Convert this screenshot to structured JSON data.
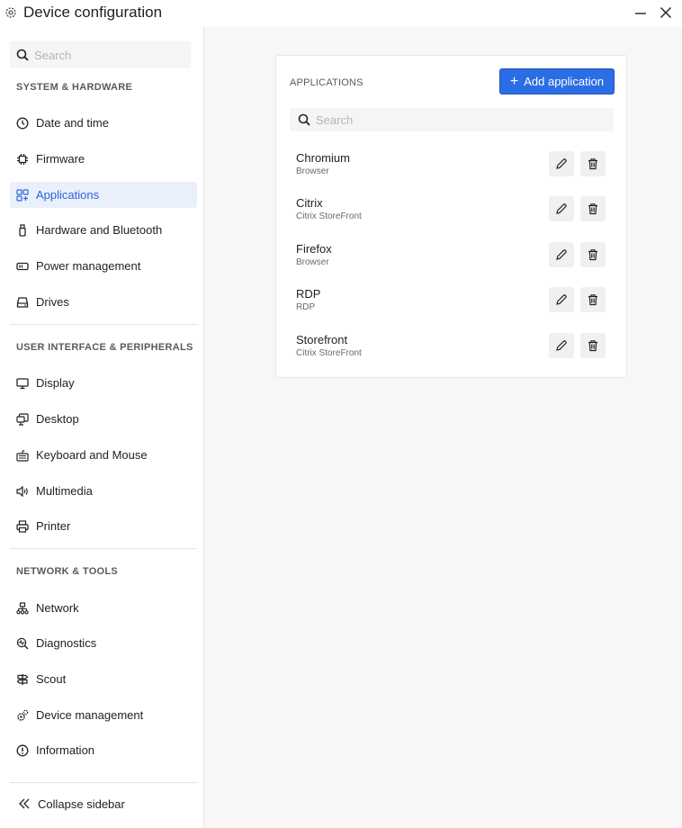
{
  "window": {
    "title": "Device configuration",
    "icon": "gear-icon"
  },
  "sidebar": {
    "search_placeholder": "Search",
    "sections": [
      {
        "label": "SYSTEM & HARDWARE",
        "items": [
          {
            "label": "Date and time",
            "icon": "clock-icon"
          },
          {
            "label": "Firmware",
            "icon": "chip-icon"
          },
          {
            "label": "Applications",
            "icon": "apps-icon",
            "active": true
          },
          {
            "label": "Hardware and Bluetooth",
            "icon": "usb-icon"
          },
          {
            "label": "Power management",
            "icon": "battery-icon"
          },
          {
            "label": "Drives",
            "icon": "drive-icon"
          }
        ]
      },
      {
        "label": "USER INTERFACE & PERIPHERALS",
        "items": [
          {
            "label": "Display",
            "icon": "monitor-icon"
          },
          {
            "label": "Desktop",
            "icon": "desktop-icon"
          },
          {
            "label": "Keyboard and Mouse",
            "icon": "keyboard-icon"
          },
          {
            "label": "Multimedia",
            "icon": "speaker-icon"
          },
          {
            "label": "Printer",
            "icon": "printer-icon"
          }
        ]
      },
      {
        "label": "NETWORK & TOOLS",
        "items": [
          {
            "label": "Network",
            "icon": "network-icon"
          },
          {
            "label": "Diagnostics",
            "icon": "diagnostics-icon"
          },
          {
            "label": "Scout",
            "icon": "signpost-icon"
          },
          {
            "label": "Device management",
            "icon": "gears-icon"
          },
          {
            "label": "Information",
            "icon": "info-icon"
          }
        ]
      }
    ],
    "collapse_label": "Collapse sidebar"
  },
  "applications": {
    "section_label": "APPLICATIONS",
    "add_button_label": "Add application",
    "search_placeholder": "Search",
    "items": [
      {
        "name": "Chromium",
        "type": "Browser"
      },
      {
        "name": "Citrix",
        "type": "Citrix StoreFront"
      },
      {
        "name": "Firefox",
        "type": "Browser"
      },
      {
        "name": "RDP",
        "type": "RDP"
      },
      {
        "name": "Storefront",
        "type": "Citrix StoreFront"
      }
    ]
  },
  "colors": {
    "accent": "#2b6de5",
    "active_bg": "#eaf0fb",
    "active_text": "#2b63d9"
  }
}
